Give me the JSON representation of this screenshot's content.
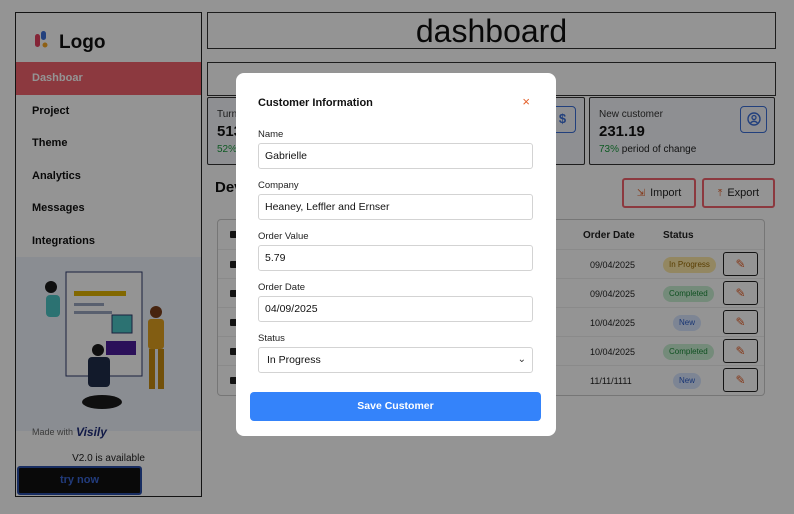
{
  "sidebar": {
    "logo_text": "Logo",
    "items": [
      {
        "label": "Dashboar"
      },
      {
        "label": "Project"
      },
      {
        "label": "Theme"
      },
      {
        "label": "Analytics"
      },
      {
        "label": "Messages"
      },
      {
        "label": "Integrations"
      }
    ],
    "made_with": "Made with",
    "brand": "Visily",
    "version_text": "V2.0 is available",
    "try_now": "try now"
  },
  "header": {
    "title": "dashboard"
  },
  "cards": [
    {
      "label": "Turn",
      "value": "513",
      "pct": "52%",
      "suffix": "",
      "icon": "dollar-icon"
    },
    {
      "label": "New customer",
      "value": "231.19",
      "pct": "73%",
      "suffix": " period of change",
      "icon": "user-circle-icon"
    }
  ],
  "section": {
    "title": "Dev",
    "import_label": "Import",
    "export_label": "Export"
  },
  "table": {
    "headers": {
      "order_date": "Order Date",
      "status": "Status"
    },
    "rows": [
      {
        "date": "09/04/2025",
        "status": "In Progress",
        "kind": "progress"
      },
      {
        "date": "09/04/2025",
        "status": "Completed",
        "kind": "completed"
      },
      {
        "date": "10/04/2025",
        "status": "New",
        "kind": "new"
      },
      {
        "date": "10/04/2025",
        "status": "Completed",
        "kind": "completed"
      },
      {
        "date": "11/11/1111",
        "status": "New",
        "kind": "new"
      }
    ]
  },
  "modal": {
    "title": "Customer Information",
    "close_glyph": "×",
    "fields": {
      "name": {
        "label": "Name",
        "value": "Gabrielle"
      },
      "company": {
        "label": "Company",
        "value": "Heaney, Leffler and Ernser"
      },
      "order_value": {
        "label": "Order Value",
        "value": "5.79"
      },
      "order_date": {
        "label": "Order Date",
        "value": "04/09/2025"
      },
      "status": {
        "label": "Status",
        "value": "In Progress"
      }
    },
    "save_label": "Save Customer"
  },
  "colors": {
    "accent_red": "#f1636d",
    "primary_blue": "#3483fa",
    "positive_green": "#1a9c3e"
  }
}
